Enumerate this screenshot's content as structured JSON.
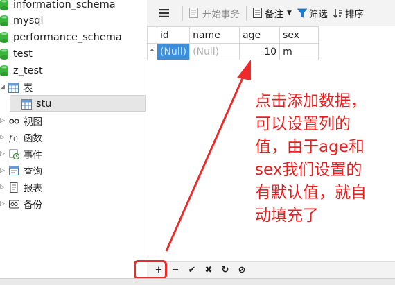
{
  "sidebar": {
    "databases": [
      {
        "name": "information_schema"
      },
      {
        "name": "mysql"
      },
      {
        "name": "performance_schema"
      },
      {
        "name": "test"
      },
      {
        "name": "z_test"
      }
    ],
    "tables_group": {
      "label": "表"
    },
    "selected_table": {
      "label": "stu"
    },
    "groups": [
      {
        "label": "视图",
        "icon": "glasses-icon"
      },
      {
        "label": "函数",
        "icon": "function-icon"
      },
      {
        "label": "事件",
        "icon": "clock-icon"
      },
      {
        "label": "查询",
        "icon": "query-icon"
      },
      {
        "label": "报表",
        "icon": "report-icon"
      },
      {
        "label": "备份",
        "icon": "backup-icon"
      }
    ]
  },
  "toolbar": {
    "begin_transaction": "开始事务",
    "memo": "备注",
    "filter": "筛选",
    "sort": "排序"
  },
  "grid": {
    "columns": [
      "id",
      "name",
      "age",
      "sex"
    ],
    "row_marker": "*",
    "rows": [
      {
        "id": "(Null)",
        "name": "(Null)",
        "age": "10",
        "sex": "m"
      }
    ]
  },
  "bottom_bar": {
    "add": "+",
    "delete": "−",
    "apply": "✔",
    "discard": "✖",
    "refresh": "↻",
    "stop": "⊘"
  },
  "annotation": {
    "lines": [
      "点击添加数据，",
      "可以设置列的",
      "值，由于age和",
      "sex我们设置的",
      "有默认值，就自",
      "动填充了"
    ]
  },
  "colors": {
    "annotation": "#ee1c1c",
    "selection": "#3b8fdb",
    "db_icon": "#3db53d"
  }
}
